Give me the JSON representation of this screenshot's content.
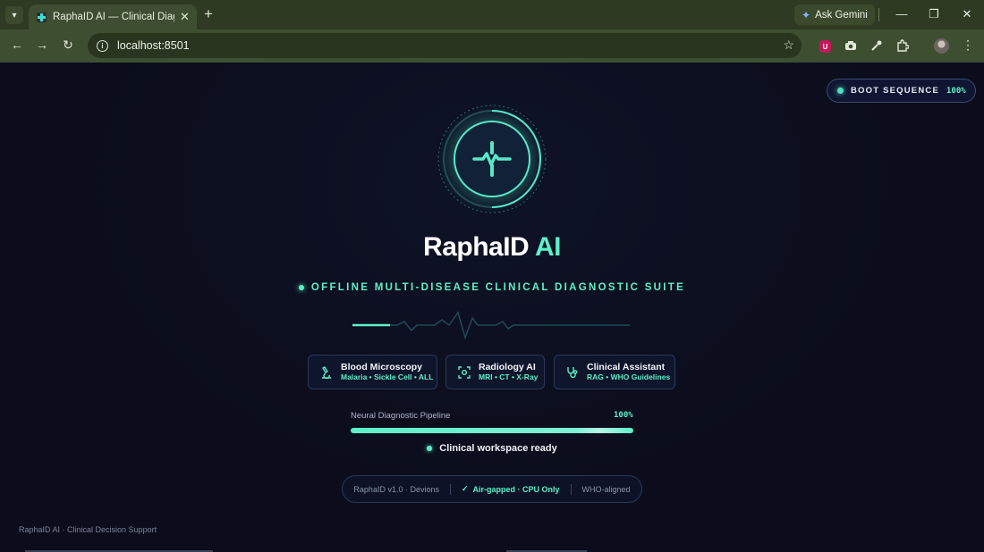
{
  "browser": {
    "tab_title": "RaphaID AI — Clinical Diagnost",
    "url": "localhost:8501",
    "ask_gemini": "Ask Gemini",
    "extension_badge": "U"
  },
  "boot": {
    "label": "BOOT SEQUENCE",
    "percent": "100%"
  },
  "brand": {
    "name": "RaphaID",
    "suffix": "AI"
  },
  "tagline": "OFFLINE MULTI-DISEASE CLINICAL DIAGNOSTIC SUITE",
  "modules": [
    {
      "title": "Blood Microscopy",
      "subtitle": "Malaria • Sickle Cell • ALL",
      "icon": "microscope-icon"
    },
    {
      "title": "Radiology AI",
      "subtitle": "MRI • CT • X-Ray",
      "icon": "scan-icon"
    },
    {
      "title": "Clinical Assistant",
      "subtitle": "RAG • WHO Guidelines",
      "icon": "stethoscope-icon"
    }
  ],
  "pipeline": {
    "label": "Neural Diagnostic Pipeline",
    "percent": "100%",
    "progress": 1.0
  },
  "status": "Clinical workspace ready",
  "footer": {
    "version": "RaphaID v1.0 · Devions",
    "airgap": "Air-gapped · CPU Only",
    "who": "WHO-aligned"
  },
  "bottom_caption": "RaphaID AI · Clinical Decision Support",
  "colors": {
    "accent": "#5ef0c8",
    "background": "#0b0d1c",
    "chrome": "#3d4f30"
  }
}
